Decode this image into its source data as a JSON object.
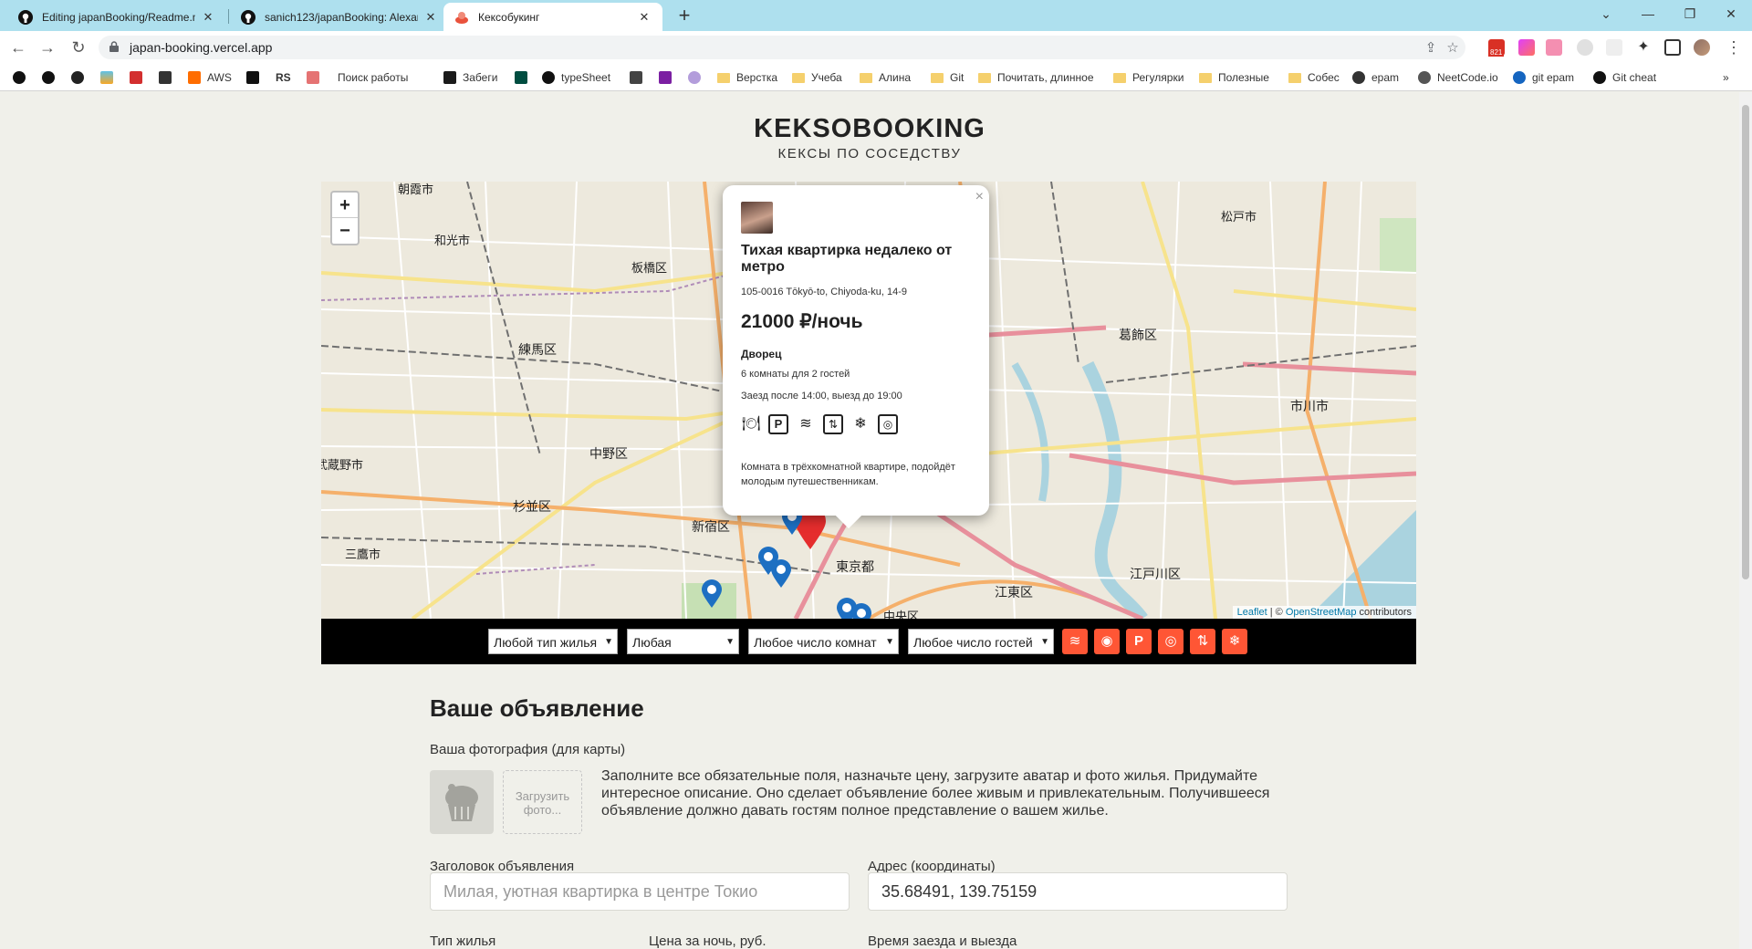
{
  "browser": {
    "tabs": [
      {
        "title": "Editing japanBooking/Readme.m",
        "icon": "github-icon"
      },
      {
        "title": "sanich123/japanBooking: Alexan",
        "icon": "github-icon"
      },
      {
        "title": "Кексобукинг",
        "icon": "keksobooking-icon"
      }
    ],
    "url": "japan-booking.vercel.app",
    "badge": "821"
  },
  "bookmarks": [
    "AWS",
    "RS",
    "Поиск работы",
    "Забеги",
    "typeSheet",
    "Верстка",
    "Учеба",
    "Алина",
    "Git",
    "Почитать, длинное",
    "Регулярки",
    "Полезные",
    "Собес",
    "epam",
    "NeetCode.io",
    "git epam",
    "Git cheat"
  ],
  "header": {
    "logo": "KEKSOBOOKING",
    "tagline": "КЕКСЫ ПО СОСЕДСТВУ"
  },
  "map": {
    "zoom_in": "+",
    "zoom_out": "−",
    "attribution_leaflet": "Leaflet",
    "attribution_sep": " | © ",
    "attribution_osm": "OpenStreetMap",
    "attribution_contrib": " contributors",
    "labels": [
      "朝霞市",
      "和光市",
      "板橋区",
      "練馬区",
      "中野区",
      "杉並区",
      "武蔵野市",
      "三鷹市",
      "新宿区",
      "東京都",
      "中央区",
      "江東区",
      "江戸川区",
      "葛飾区",
      "市川市",
      "松戸市"
    ]
  },
  "popup": {
    "close": "×",
    "title": "Тихая квартирка недалеко от метро",
    "address": "105-0016 Tōkyō-to, Chiyoda-ku, 14-9",
    "price": "21000 ₽/ночь",
    "type": "Дворец",
    "capacity": "6 комнаты для 2 гостей",
    "time": "Заезд после 14:00, выезд до 19:00",
    "features": [
      "dishwasher-icon",
      "parking-icon",
      "wifi-icon",
      "elevator-icon",
      "conditioner-icon",
      "washer-icon"
    ],
    "description": "Комната в трёхкомнатной квартире, подойдёт молодым путешественникам."
  },
  "filters": {
    "type": "Любой тип жилья",
    "price": "Любая",
    "rooms": "Любое число комнат",
    "guests": "Любое число гостей",
    "feature_icons": [
      "wifi-icon",
      "dishwasher-icon",
      "parking-icon",
      "washer-icon",
      "elevator-icon",
      "conditioner-icon"
    ],
    "accent": "#ff5635"
  },
  "form": {
    "heading": "Ваше объявление",
    "photo_label": "Ваша фотография (для карты)",
    "upload": "Загрузить фото...",
    "hint": "Заполните все обязательные поля, назначьте цену, загрузите аватар и фото жилья. Придумайте интересное описание. Оно сделает объявление более живым и привлекательным. Получившееся объявление должно давать гостям полное представление о вашем жилье.",
    "title_label": "Заголовок объявления",
    "title_placeholder": "Милая, уютная квартирка в центре Токио",
    "address_label": "Адрес (координаты)",
    "address_value": "35.68491, 139.75159",
    "type_label": "Тип жилья",
    "price_label": "Цена за ночь, руб.",
    "time_label": "Время заезда и выезда"
  }
}
